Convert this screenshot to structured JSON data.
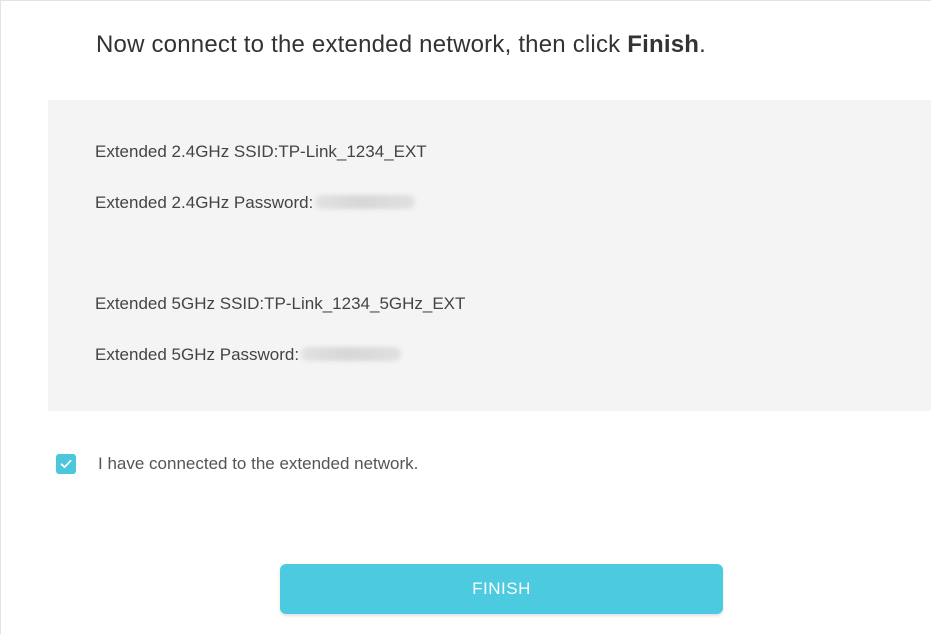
{
  "header": {
    "instruction_prefix": "Now connect to the extended network, then click ",
    "instruction_emphasis": "Finish",
    "instruction_suffix": "."
  },
  "network_info": {
    "ssid_24_label": "Extended 2.4GHz SSID:",
    "ssid_24_value": "TP-Link_1234_EXT",
    "password_24_label": "Extended 2.4GHz Password:",
    "ssid_5_label": "Extended 5GHz SSID:",
    "ssid_5_value": "TP-Link_1234_5GHz_EXT",
    "password_5_label": "Extended 5GHz Password:"
  },
  "confirmation": {
    "checked": true,
    "label": "I have connected to the extended network."
  },
  "actions": {
    "finish_label": "FINISH"
  },
  "colors": {
    "accent": "#4ccadf",
    "checkbox": "#4cc6db",
    "panel_background": "#f4f4f4",
    "text": "#444444"
  }
}
